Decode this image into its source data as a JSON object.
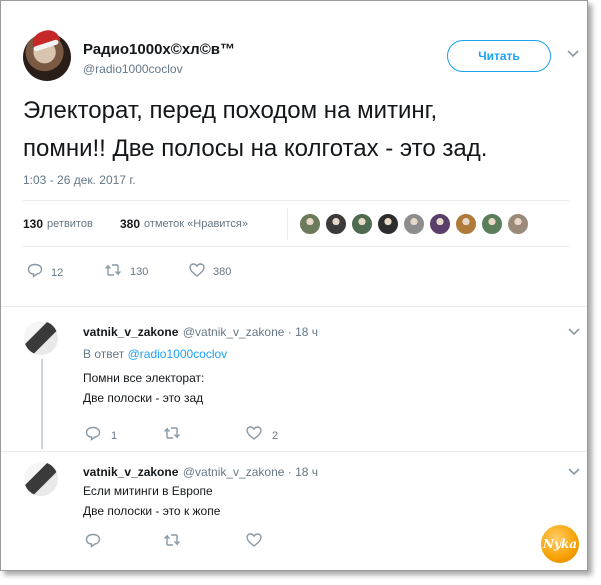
{
  "tweet": {
    "display_name": "Радио1000х©хл©в™",
    "handle": "@radio1000coclov",
    "follow_label": "Читать",
    "text_line1": "Электорат, перед походом на митинг,",
    "text_line2": "помни!! Две полосы на колготах - это зад.",
    "timestamp": "1:03 - 26 дек. 2017 г.",
    "retweets_num": "130",
    "retweets_label": "ретвитов",
    "likes_num": "380",
    "likes_label": "отметок «Нравится»",
    "actions": {
      "reply_count": "12",
      "retweet_count": "130",
      "like_count": "380"
    },
    "likers": [
      "#6b7a5a",
      "#3b3b3b",
      "#4f6b4f",
      "#2d2d2d",
      "#8d8d8d",
      "#5a3f6a",
      "#b07a3a",
      "#5a7d5a",
      "#9a8a7a"
    ]
  },
  "replies": [
    {
      "name": "vatnik_v_zakone",
      "handle": "@vatnik_v_zakone · 18 ч",
      "in_reply_prefix": "В ответ",
      "in_reply_handle": "@radio1000coclov",
      "line1": "Помни все электорат:",
      "line2": "Две полоски - это зад",
      "reply_count": "1",
      "retweet_count": "",
      "like_count": "2"
    },
    {
      "name": "vatnik_v_zakone",
      "handle": "@vatnik_v_zakone · 18 ч",
      "line1": "Если митинги в Европе",
      "line2": "Две полоски - это к жопе",
      "reply_count": "",
      "retweet_count": "",
      "like_count": ""
    }
  ],
  "icons": {
    "reply": "reply-icon",
    "retweet": "retweet-icon",
    "like": "heart-icon",
    "more": "chevron-down-icon"
  },
  "watermark": "Nyka",
  "colors": {
    "accent": "#1da1f2",
    "muted": "#657786",
    "divider": "#e6ecf0"
  }
}
